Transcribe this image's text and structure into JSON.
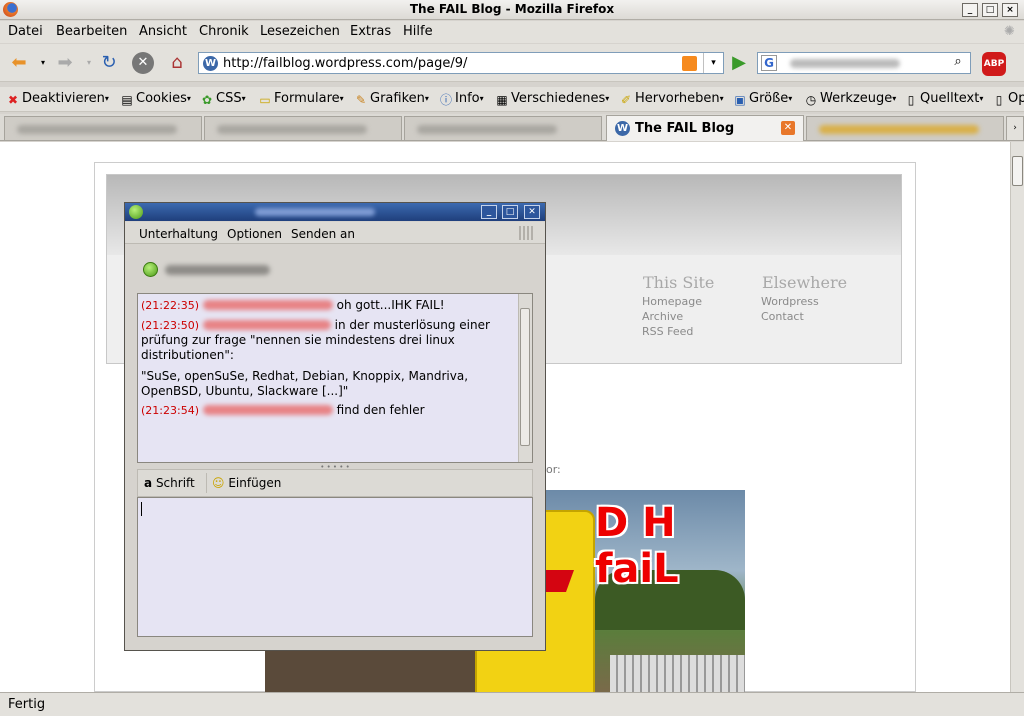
{
  "window": {
    "title": "The FAIL Blog - Mozilla Firefox"
  },
  "menubar": [
    "Datei",
    "Bearbeiten",
    "Ansicht",
    "Chronik",
    "Lesezeichen",
    "Extras",
    "Hilfe"
  ],
  "address": {
    "url": "http://failblog.wordpress.com/page/9/"
  },
  "bookmarks": [
    "Deaktivieren",
    "Cookies",
    "CSS",
    "Formulare",
    "Grafiken",
    "Info",
    "Verschiedenes",
    "Hervorheben",
    "Größe",
    "Werkzeuge",
    "Quelltext",
    "Op"
  ],
  "tabs": {
    "active_label": "The FAIL Blog"
  },
  "status": "Fertig",
  "blog": {
    "this_site_heading": "This Site",
    "this_site_links": [
      "Homepage",
      "Archive",
      "RSS Feed"
    ],
    "elsewhere_heading": "Elsewhere",
    "elsewhere_links": [
      "Wordpress",
      "Contact"
    ],
    "partial_text": "or:",
    "image_caption": "D H faiL"
  },
  "chat": {
    "menu": [
      "Unterhaltung",
      "Optionen",
      "Senden an"
    ],
    "messages": [
      {
        "time": "(21:22:35)",
        "text": "oh gott...IHK FAIL!"
      },
      {
        "time": "(21:23:50)",
        "text": "in der musterlösung einer prüfung zur frage \"nennen sie mindestens drei linux distributionen\":"
      },
      {
        "time": "",
        "text": "\"SuSe, openSuSe, Redhat, Debian, Knoppix, Mandriva, OpenBSD, Ubuntu, Slackware [...]\""
      },
      {
        "time": "(21:23:54)",
        "text": "find den fehler"
      }
    ],
    "toolbar": {
      "font_label": "Schrift",
      "insert_label": "Einfügen"
    }
  },
  "colors": {
    "accent": "#2d569c",
    "timestamp": "#cc0000",
    "chat_bg": "#e6e4f3"
  }
}
